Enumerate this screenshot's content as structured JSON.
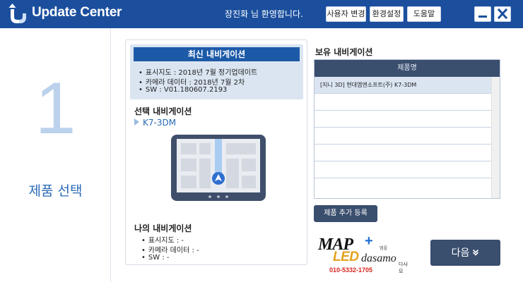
{
  "titlebar": {
    "app_title": "Update Center",
    "welcome_name": "장진화",
    "welcome_text": "님 환영합니다.",
    "buttons": {
      "user_change": "사용자 변경",
      "settings": "환경설정",
      "help": "도움말"
    }
  },
  "step": {
    "number": "1",
    "label": "제품 선택"
  },
  "latest_nav": {
    "title": "최신 내비게이션",
    "lines": [
      "표시지도 : 2018년 7월 정기업데이트",
      "카메라 데이터 : 2018년 7월 2차",
      "SW : V01.180607.2193"
    ]
  },
  "selected_nav": {
    "title": "선택 내비게이션",
    "item": "K7-3DM"
  },
  "my_nav": {
    "title": "나의 내비게이션",
    "lines": [
      "표시지도 : -",
      "카메라 데이터 : -",
      "SW : -"
    ]
  },
  "owned_nav": {
    "title": "보유 내비게이션",
    "column_header": "제품명",
    "rows": [
      "[지니 3D] 현대엠엔소프트(주) K7-3DM"
    ]
  },
  "actions": {
    "add_product": "제품 추가 등록",
    "next": "다음",
    "next_icon": "chevron-double-down-icon"
  },
  "ad": {
    "map": "MAP",
    "plus": "+",
    "map_sub": "맵플",
    "led": "LED",
    "dasamo": "dasamo",
    "dasamo_sub": "다사모",
    "phone": "010-5332-1705"
  },
  "colors": {
    "titlebar": "#1b4f9e",
    "accent_blue": "#2a6ab7",
    "step_number": "#bcd2ec",
    "dark_button": "#3a4e6e",
    "header_bar": "#1c5aa8",
    "info_box": "#dbe5f2"
  }
}
